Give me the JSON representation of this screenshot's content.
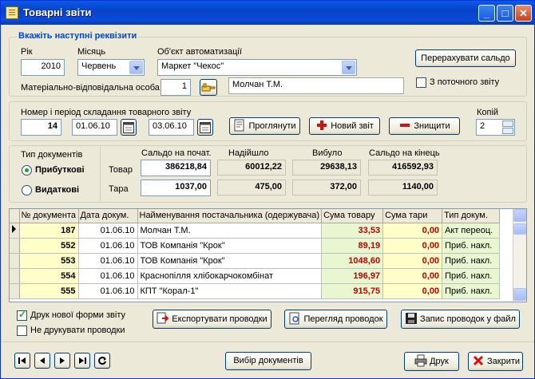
{
  "window": {
    "title": "Товарні звіти"
  },
  "params": {
    "group_title": "Вкажіть наступні реквізити",
    "year_label": "Рік",
    "year_value": "2010",
    "month_label": "Місяць",
    "month_value": "Червень",
    "object_label": "Об'єкт автоматизації",
    "object_value": "Маркет \"Чекос\"",
    "recalc_button": "Перерахувати сальдо",
    "from_current_label": "З поточного звіту",
    "from_current_checked": false,
    "person_label": "Матеріально-відповідальна особа",
    "person_id": "1",
    "person_name": "Молчан Т.М."
  },
  "report": {
    "period_label": "Номер і період складання товарного звіту",
    "number": "14",
    "date_from": "01.06.10",
    "date_to": "03.06.10",
    "view_button": "Проглянути",
    "new_button": "Новий звіт",
    "delete_button": "Знищити",
    "copies_label": "Копій",
    "copies_value": "2"
  },
  "doc_types": {
    "label": "Тип документів",
    "option_in": "Прибуткові",
    "option_out": "Видаткові",
    "selected": "Прибуткові"
  },
  "balances": {
    "headers": [
      "Сальдо на почат.",
      "Надійшло",
      "Вибуло",
      "Сальдо на кінець"
    ],
    "goods_label": "Товар",
    "tare_label": "Тара",
    "goods": [
      "386218,84",
      "60012,22",
      "29638,13",
      "416592,93"
    ],
    "tare": [
      "1037,00",
      "475,00",
      "372,00",
      "1140,00"
    ]
  },
  "table": {
    "columns": [
      "№ документа",
      "Дата докум.",
      "Найменування постачальника (одержувача)",
      "Сума товару",
      "Сума тари",
      "Тип докум."
    ],
    "rows": [
      {
        "num": "187",
        "date": "01.06.10",
        "name": "Молчан Т.М.",
        "goods": "33,53",
        "tare": "0,00",
        "type": "Акт переоц."
      },
      {
        "num": "552",
        "date": "01.06.10",
        "name": "ТОВ Компанія \"Крок\"",
        "goods": "89,19",
        "tare": "0,00",
        "type": "Приб. накл."
      },
      {
        "num": "553",
        "date": "01.06.10",
        "name": "ТОВ Компанія \"Крок\"",
        "goods": "1048,60",
        "tare": "0,00",
        "type": "Приб. накл."
      },
      {
        "num": "554",
        "date": "01.06.10",
        "name": "Краснопілля хлібокарчокомбінат",
        "goods": "196,97",
        "tare": "0,00",
        "type": "Приб. накл."
      },
      {
        "num": "555",
        "date": "01.06.10",
        "name": "КПТ \"Корал-1\"",
        "goods": "915,75",
        "tare": "0,00",
        "type": "Приб. накл."
      }
    ]
  },
  "bottom": {
    "print_new_form_label": "Друк нової форми звіту",
    "print_new_form_checked": true,
    "no_print_entries_label": "Не друкувати проводки",
    "no_print_entries_checked": false,
    "export_button": "Експортувати проводки",
    "preview_button": "Перегляд проводок",
    "save_button": "Запис проводок у файл",
    "select_docs_button": "Вибір документів",
    "print_button": "Друк",
    "close_button": "Закрити"
  },
  "colors": {
    "accent_blue": "#0046d5",
    "amount_red": "#c00000",
    "row_yellow": "#fffdc8",
    "row_green": "#e8f7d0"
  }
}
